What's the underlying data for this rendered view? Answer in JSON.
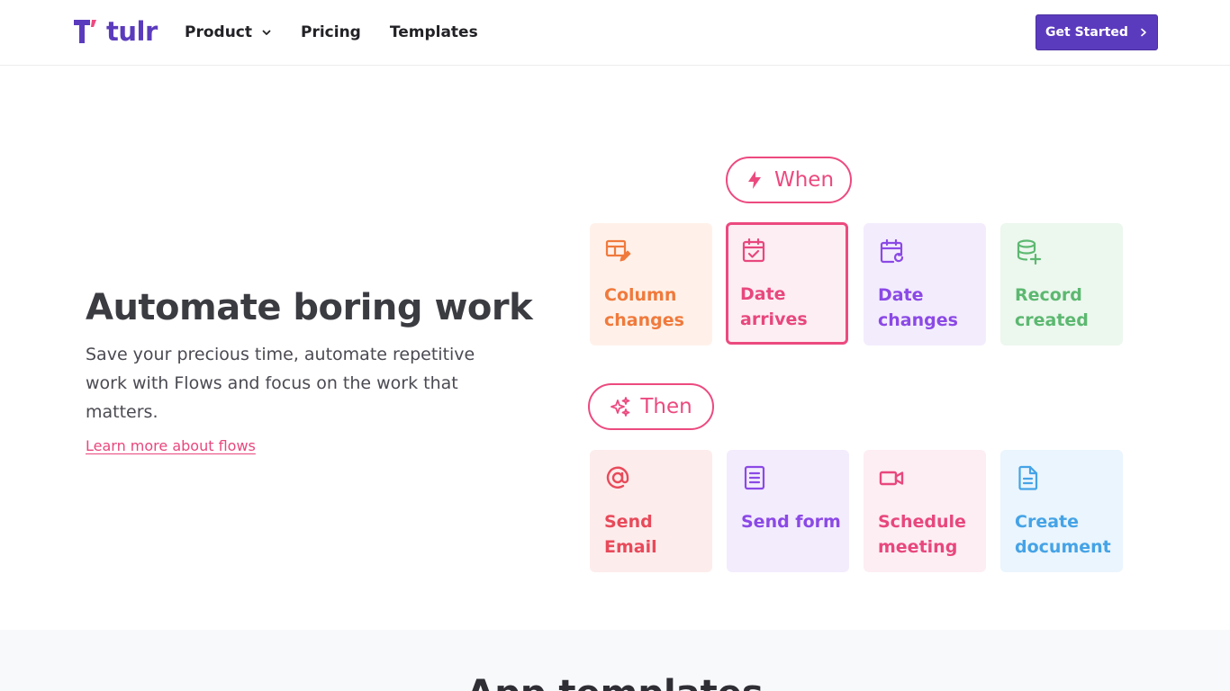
{
  "header": {
    "logo_text": "tulr",
    "nav": [
      {
        "label": "Product",
        "has_dropdown": true
      },
      {
        "label": "Pricing"
      },
      {
        "label": "Templates"
      }
    ],
    "cta_label": "Get Started",
    "brand_color": "#5b3bbd"
  },
  "hero": {
    "title": "Automate boring work",
    "subtitle": "Save your precious time, automate repetitive work with Flows and focus on the work that matters.",
    "link_label": "Learn more about flows"
  },
  "flow": {
    "accent_color": "#ec4a7f",
    "when": {
      "label": "When",
      "icon": "lightning-icon",
      "triggers": [
        {
          "label": "Column changes",
          "icon": "table-edit-icon",
          "color": "#f07a3c",
          "bg": "#fff1ea",
          "selected": false
        },
        {
          "label": "Date arrives",
          "icon": "calendar-check-icon",
          "color": "#e8477d",
          "bg": "#fdeef3",
          "selected": true
        },
        {
          "label": "Date changes",
          "icon": "calendar-refresh-icon",
          "color": "#8b49e6",
          "bg": "#f3ecfd",
          "selected": false
        },
        {
          "label": "Record created",
          "icon": "database-plus-icon",
          "color": "#5cb870",
          "bg": "#ecf7ee",
          "selected": false
        }
      ]
    },
    "then": {
      "label": "Then",
      "icon": "sparkles-icon",
      "actions": [
        {
          "label": "Send Email",
          "icon": "at-sign-icon",
          "color": "#e84a5a",
          "bg": "#fdecec"
        },
        {
          "label": "Send form",
          "icon": "form-icon",
          "color": "#8b49e6",
          "bg": "#f3ecfd"
        },
        {
          "label": "Schedule meeting",
          "icon": "video-camera-icon",
          "color": "#e8477d",
          "bg": "#fdeef3"
        },
        {
          "label": "Create document",
          "icon": "document-icon",
          "color": "#45a3e6",
          "bg": "#eaf5fd"
        }
      ]
    }
  },
  "next_section": {
    "heading": "App templates"
  }
}
